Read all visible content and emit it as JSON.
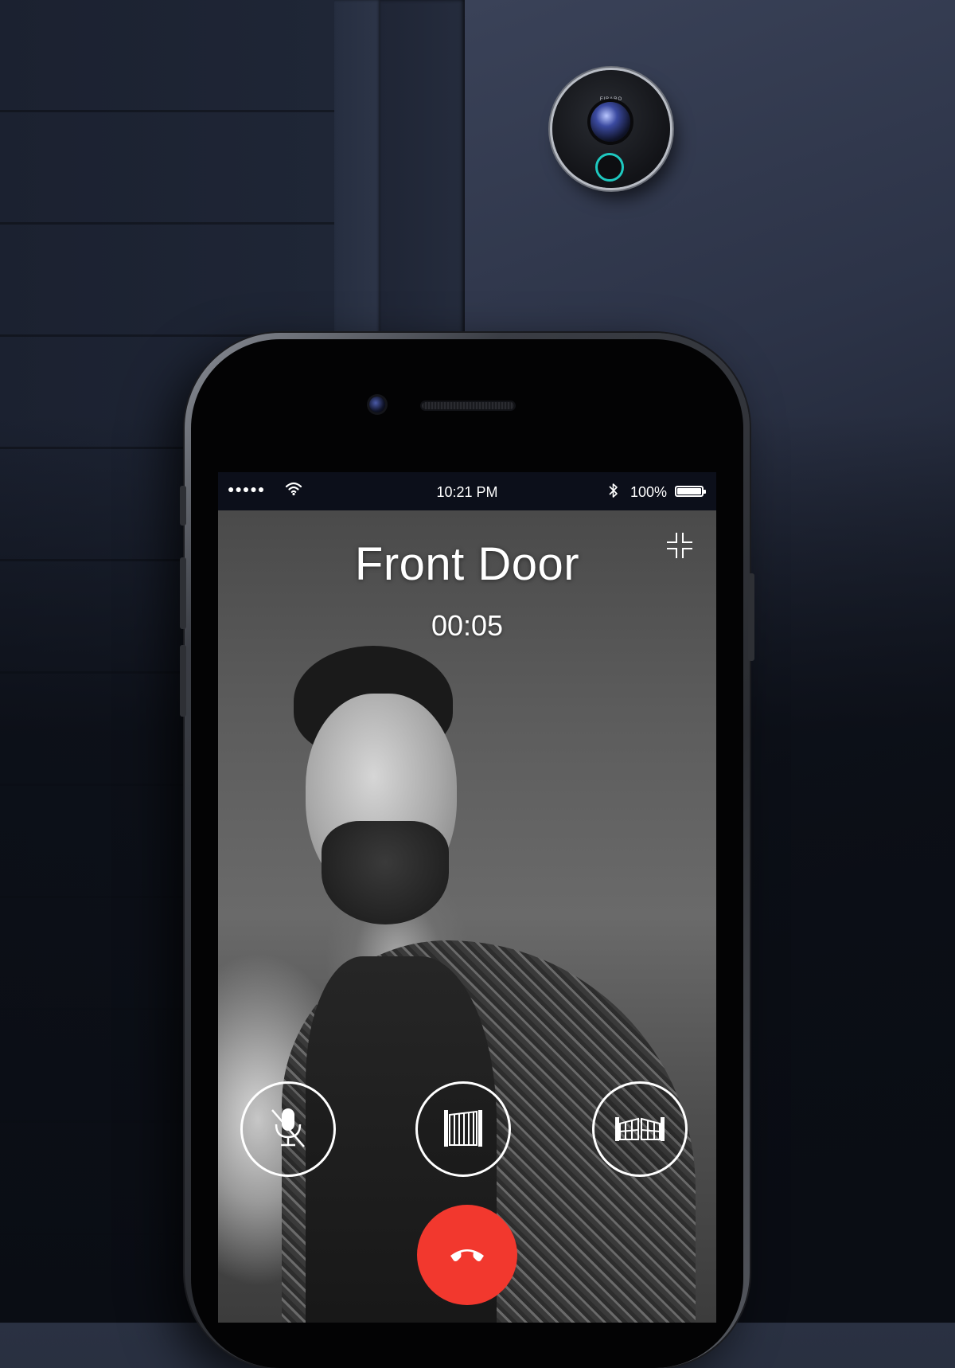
{
  "status_bar": {
    "signal": "●●●●●",
    "time": "10:21 PM",
    "battery": "100%"
  },
  "call": {
    "title": "Front Door",
    "duration": "00:05"
  },
  "doorbell": {
    "brand": "FIBARO"
  },
  "icons": {
    "minimize": "minimize-icon",
    "mute": "mic-off-icon",
    "gate": "gate-icon",
    "fence_gate": "fence-gate-icon",
    "hangup": "phone-hangup-icon"
  },
  "colors": {
    "hangup": "#f2382e",
    "status_bar": "#0c0f1a",
    "doorbell_ring": "#1ec9c0"
  }
}
